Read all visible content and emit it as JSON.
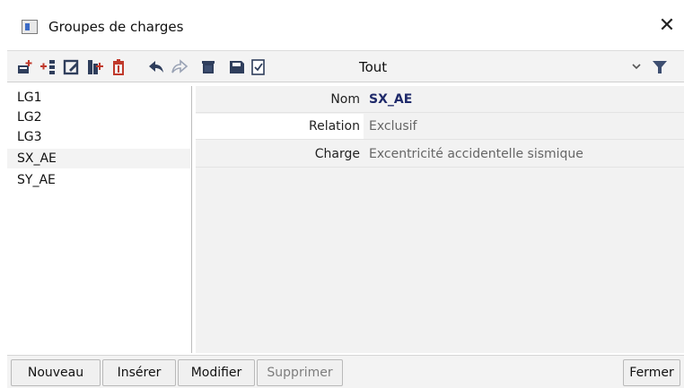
{
  "window": {
    "title": "Groupes de charges",
    "close_glyph": "✕"
  },
  "toolbar": {
    "icons": [
      "new-row-icon",
      "insert-row-icon",
      "edit-icon",
      "copy-icon",
      "delete-icon",
      "undo-icon",
      "redo-icon",
      "clear-icon",
      "save-icon",
      "check-icon"
    ],
    "filter_label": "Tout",
    "filter_chevron": "chevron-down-icon",
    "filter_icon": "funnel-icon"
  },
  "list": {
    "items": [
      "LG1",
      "LG2",
      "LG3",
      "SX_AE",
      "SY_AE"
    ],
    "selected": "SX_AE"
  },
  "properties": {
    "rows": [
      {
        "label": "Nom",
        "value": "SX_AE"
      },
      {
        "label": "Relation",
        "value": "Exclusif"
      },
      {
        "label": "Charge",
        "value": "Excentricité accidentelle sismique"
      }
    ]
  },
  "buttons": {
    "new": "Nouveau",
    "insert": "Insérer",
    "modify": "Modifier",
    "delete": "Supprimer",
    "close": "Fermer"
  },
  "colors": {
    "accent": "#c0392b",
    "selection": "#f3f3f3",
    "name_value": "#1f2a6a",
    "icon_dark": "#2f3e5c"
  }
}
